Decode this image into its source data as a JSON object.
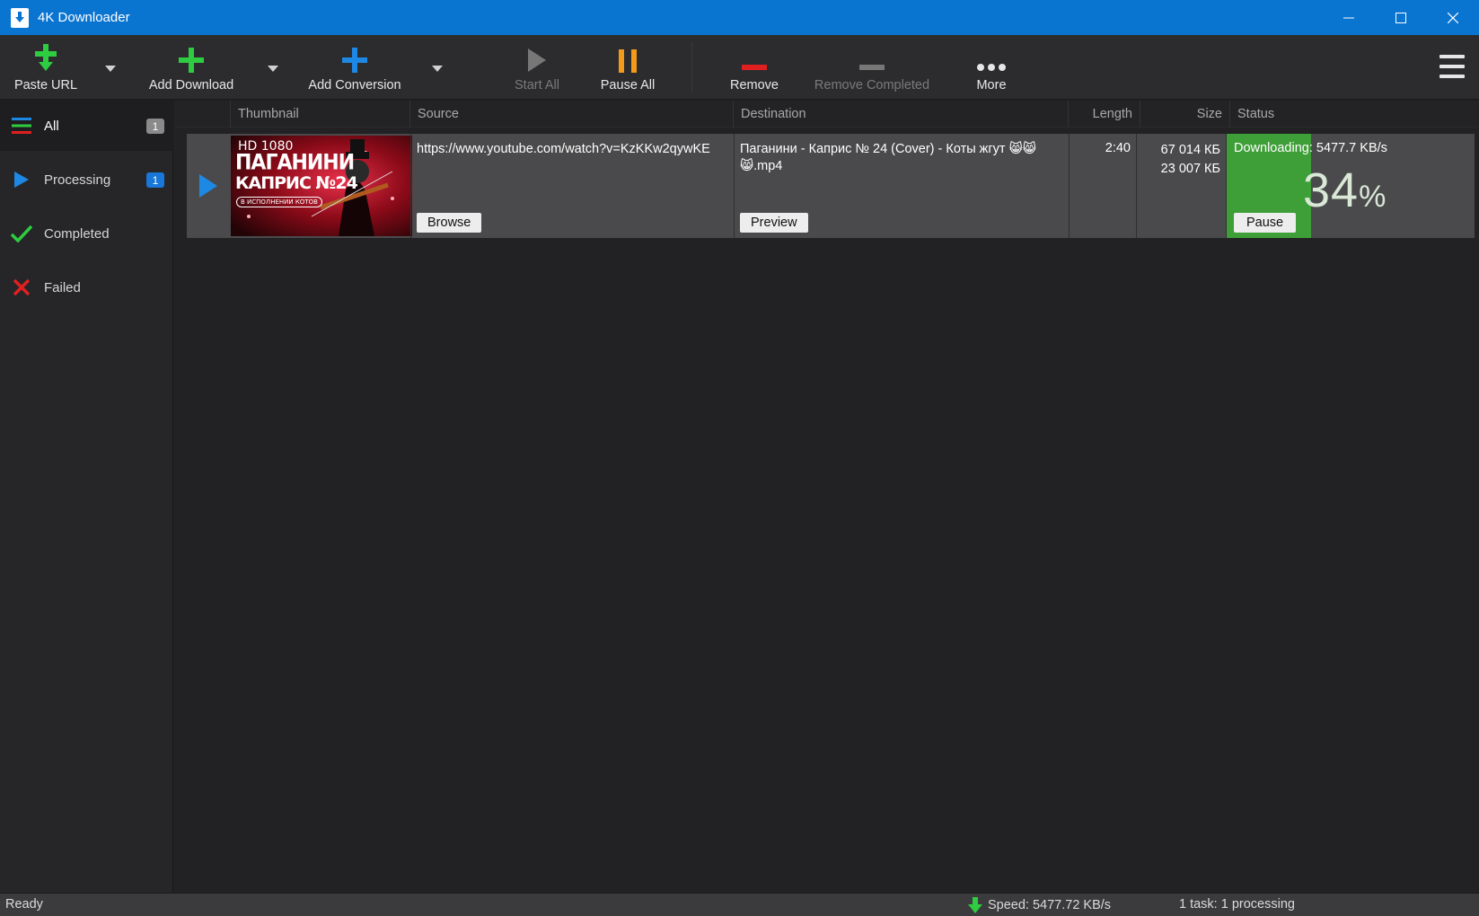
{
  "window": {
    "title": "4K Downloader"
  },
  "toolbar": {
    "paste_url": "Paste URL",
    "add_download": "Add Download",
    "add_conversion": "Add Conversion",
    "start_all": "Start All",
    "pause_all": "Pause All",
    "remove": "Remove",
    "remove_completed": "Remove Completed",
    "more": "More"
  },
  "sidebar": {
    "items": [
      {
        "label": "All",
        "badge": "1",
        "icon": "list-icon"
      },
      {
        "label": "Processing",
        "badge": "1",
        "icon": "play-icon"
      },
      {
        "label": "Completed",
        "icon": "check-icon"
      },
      {
        "label": "Failed",
        "icon": "cross-icon"
      }
    ]
  },
  "columns": {
    "thumbnail": "Thumbnail",
    "source": "Source",
    "destination": "Destination",
    "length": "Length",
    "size": "Size",
    "status": "Status"
  },
  "rows": [
    {
      "thumbnail_text": {
        "line1": "HD 1080",
        "line2": "ПАГАНИНИ",
        "line3": "КАПРИС №24",
        "line4": "В ИСПОЛНЕНИИ КОТОВ"
      },
      "source": "https://www.youtube.com/watch?v=KzKKw2qywKE",
      "browse_label": "Browse",
      "destination_line1": "Паганини - Каприс № 24 (Cover) - Коты жгут 😸😸",
      "destination_line2": "😸.mp4",
      "preview_label": "Preview",
      "length": "2:40",
      "size_total": "67 014 КБ",
      "size_downloaded": "23 007 КБ",
      "status": "Downloading: 5477.7 KB/s",
      "percent": "34",
      "percent_sign": "%",
      "progress": 0.34,
      "pause_label": "Pause"
    }
  ],
  "statusbar": {
    "ready": "Ready",
    "speed": "Speed: 5477.72 KB/s",
    "tasks": "1 task: 1 processing"
  },
  "colors": {
    "titlebar": "#0a74d1",
    "progress": "#3e9e38",
    "accent_blue": "#1877d8",
    "add_green": "#2ecc40",
    "pause_orange": "#f39a1a",
    "remove_red": "#e02020"
  }
}
